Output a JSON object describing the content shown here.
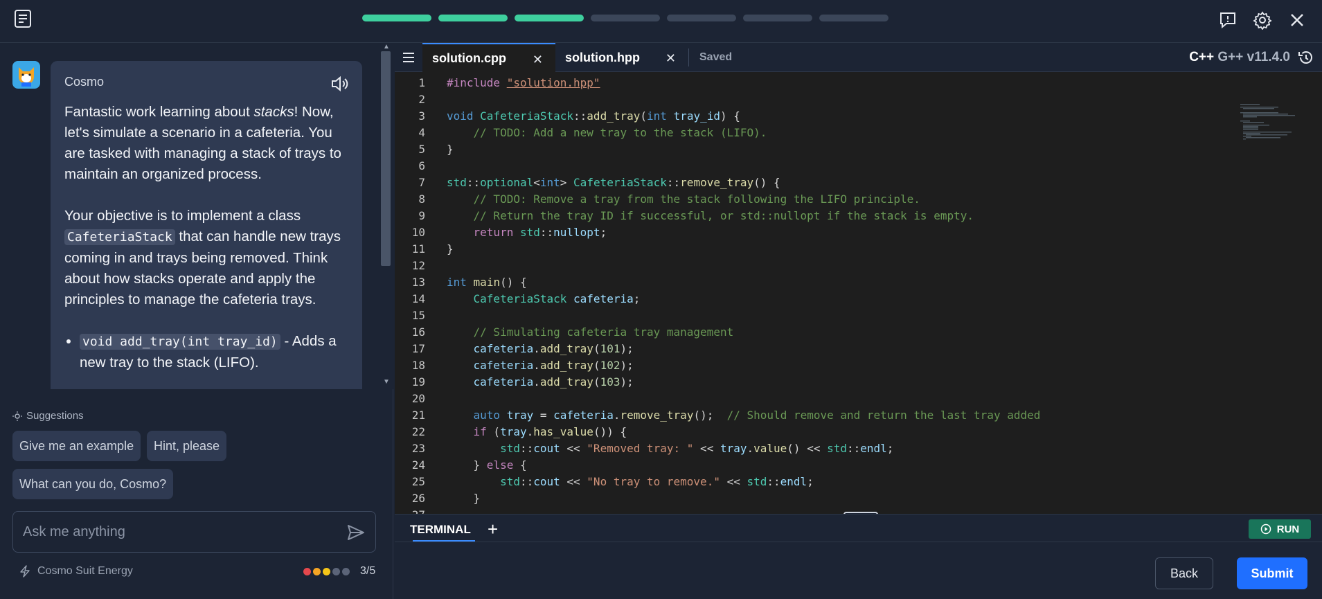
{
  "header": {
    "progress_steps": [
      true,
      true,
      true,
      false,
      false,
      false,
      false
    ]
  },
  "chat": {
    "bot_name": "Cosmo",
    "para1_a": "Fantastic work learning about ",
    "para1_em": "stacks",
    "para1_b": "! Now, let's simulate a scenario in a cafeteria. You are tasked with managing a stack of trays to maintain an organized process.",
    "para2_a": "Your objective is to implement a class ",
    "para2_code": "CafeteriaStack",
    "para2_b": " that can handle new trays coming in and trays being removed. Think about how stacks operate and apply the principles to manage the cafeteria trays.",
    "bullet1_code": "void add_tray(int tray_id)",
    "bullet1_text": " - Adds a new tray to the stack (LIFO)."
  },
  "suggestions": {
    "title": "Suggestions",
    "items": [
      "Give me an example",
      "Hint, please",
      "What can you do, Cosmo?"
    ]
  },
  "ask": {
    "placeholder": "Ask me anything"
  },
  "energy": {
    "label": "Cosmo Suit Energy",
    "count": "3/5",
    "dot_colors": [
      "#e5484d",
      "#f5a524",
      "#f5c518",
      "#5b6478",
      "#5b6478"
    ]
  },
  "editor": {
    "tabs": [
      "solution.cpp",
      "solution.hpp"
    ],
    "saved": "Saved",
    "lang": "C++",
    "version": "G++ v11.4.0"
  },
  "terminal": {
    "label": "TERMINAL",
    "run": "RUN"
  },
  "footer": {
    "back": "Back",
    "submit": "Submit"
  }
}
